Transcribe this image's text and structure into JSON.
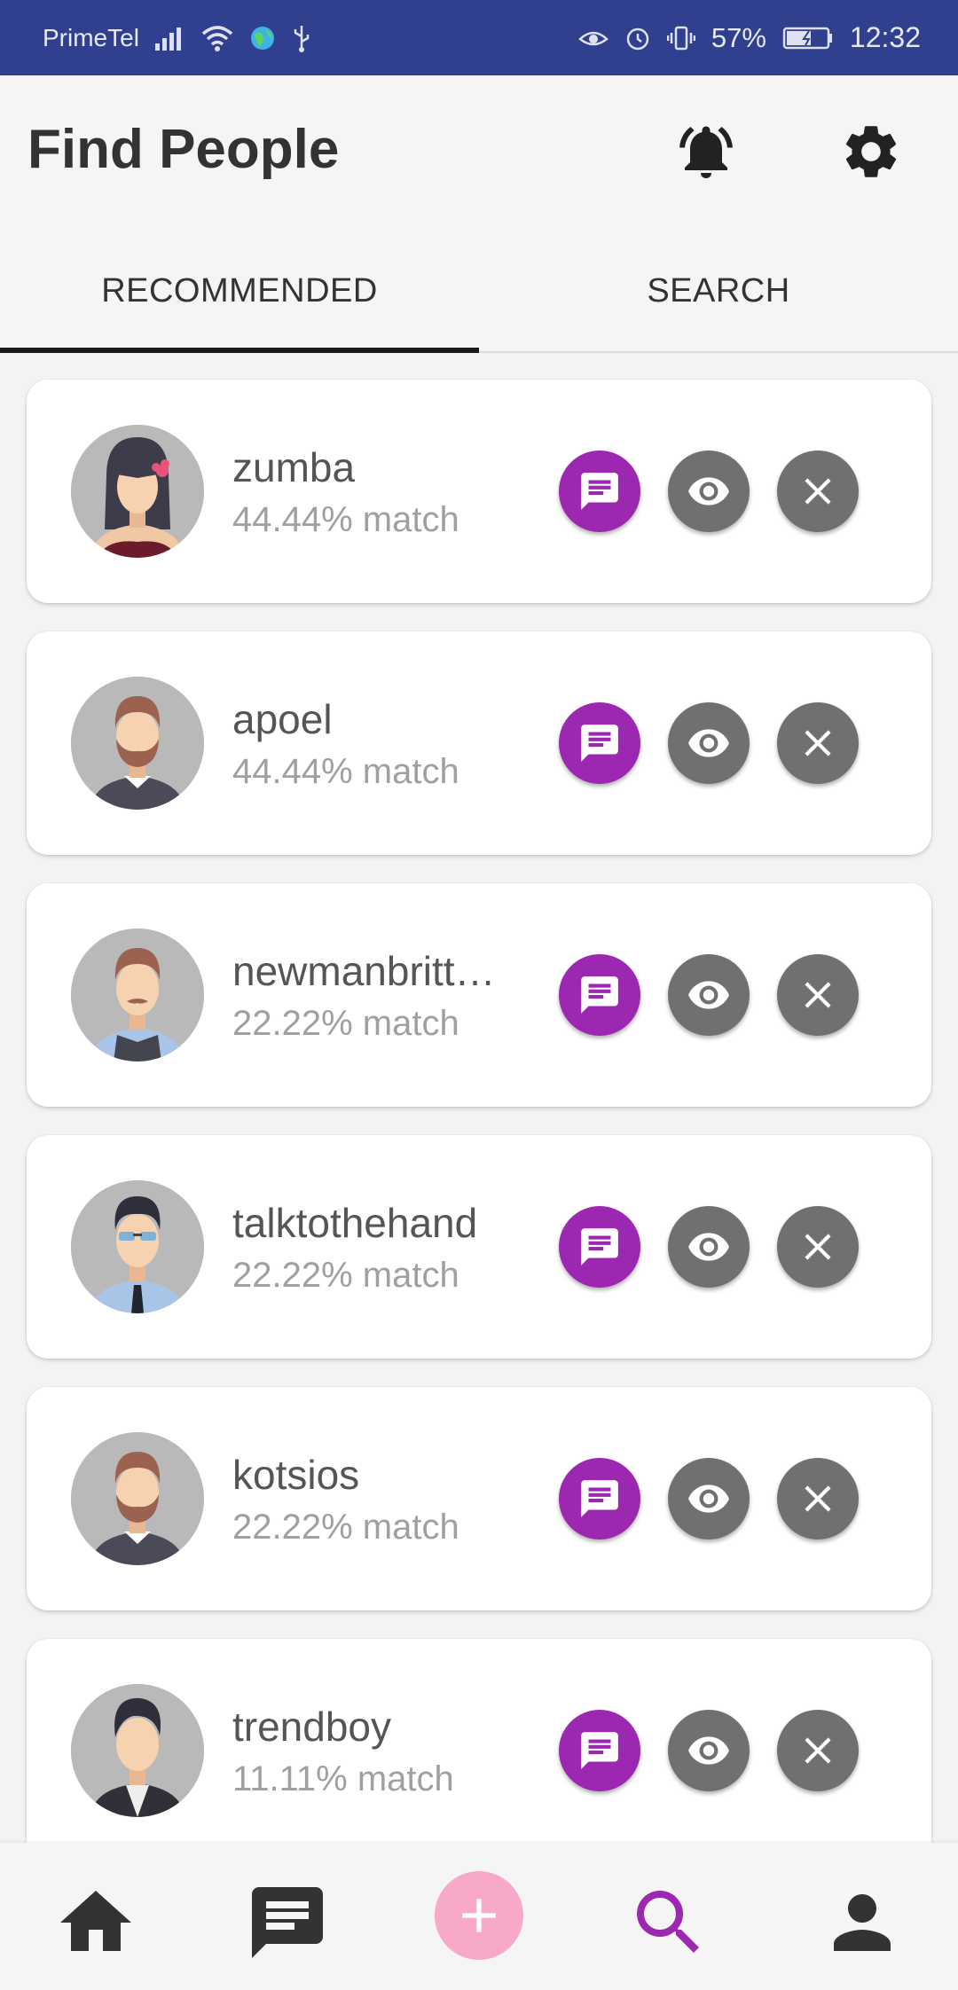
{
  "status_bar": {
    "carrier": "PrimeTel",
    "battery": "57%",
    "time": "12:32"
  },
  "header": {
    "title": "Find People",
    "icons": [
      "bell-icon",
      "gear-icon"
    ]
  },
  "tabs": [
    {
      "label": "RECOMMENDED",
      "active": true
    },
    {
      "label": "SEARCH",
      "active": false
    }
  ],
  "people": [
    {
      "name": "zumba",
      "match": "44.44% match",
      "avatar": "woman-avatar"
    },
    {
      "name": "apoel",
      "match": "44.44% match",
      "avatar": "bearded-man-avatar"
    },
    {
      "name": "newmanbritt…",
      "match": "22.22% match",
      "avatar": "mustache-man-avatar"
    },
    {
      "name": "talktothehand",
      "match": "22.22% match",
      "avatar": "sunglasses-man-avatar"
    },
    {
      "name": "kotsios",
      "match": "22.22% match",
      "avatar": "bearded-man-avatar"
    },
    {
      "name": "trendboy",
      "match": "11.11% match",
      "avatar": "suit-man-avatar"
    }
  ],
  "bottom_nav": {
    "items": [
      "home-icon",
      "messages-icon",
      "add-icon",
      "search-icon",
      "profile-icon"
    ],
    "active": "search-icon"
  },
  "colors": {
    "status_bar": "#303f8e",
    "accent": "#9c27b0",
    "fab": "#f8a8c8",
    "action_gray": "#707070"
  }
}
